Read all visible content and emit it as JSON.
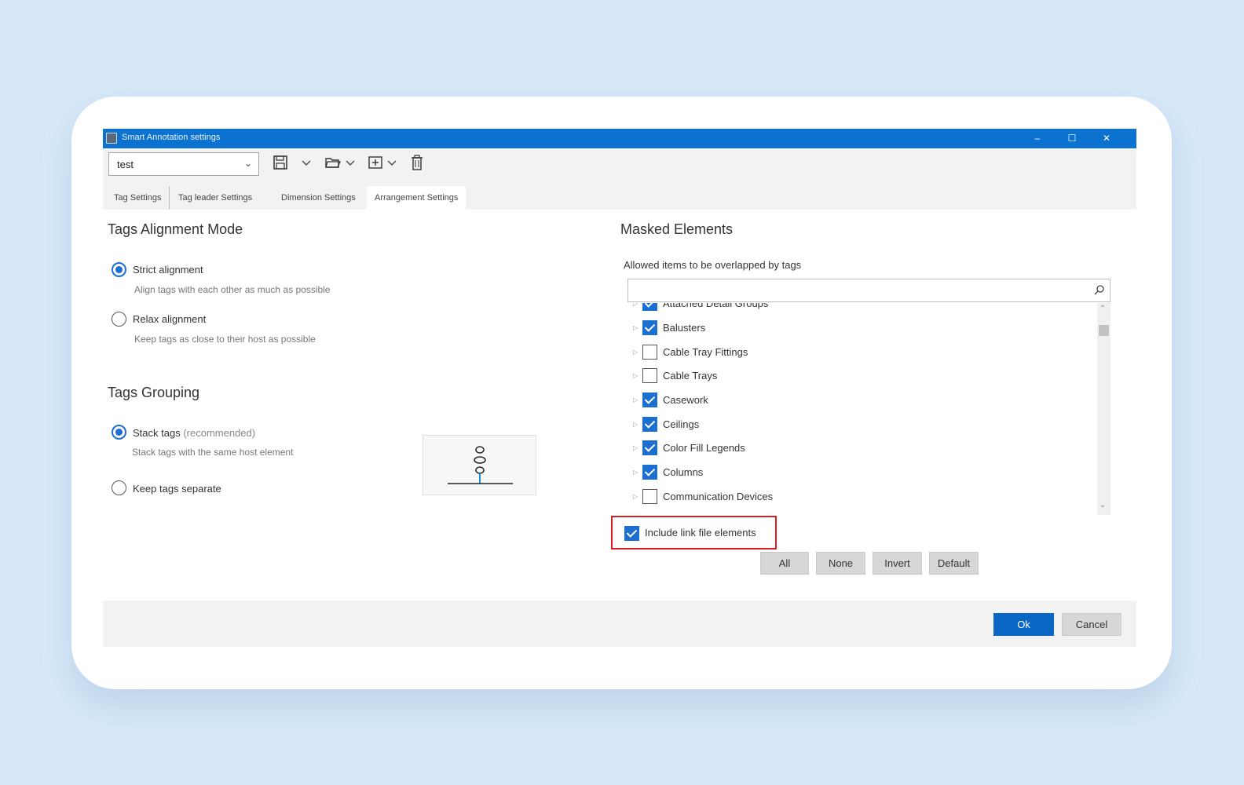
{
  "window": {
    "title": "Smart Annotation settings",
    "controls": {
      "minimize": "–",
      "maximize": "☐",
      "close": "✕"
    }
  },
  "toolbar": {
    "preset_value": "test",
    "icons": [
      "save-icon",
      "chevron-down-icon",
      "folder-open-icon",
      "chevron-down-icon",
      "add-box-icon",
      "chevron-down-icon",
      "trash-icon"
    ]
  },
  "tabs": [
    {
      "label": "Tag Settings",
      "active": false
    },
    {
      "label": "Tag leader Settings",
      "active": false
    },
    {
      "label": "Dimension Settings",
      "active": false
    },
    {
      "label": "Arrangement Settings",
      "active": true
    }
  ],
  "alignment": {
    "title": "Tags Alignment Mode",
    "options": [
      {
        "label": "Strict alignment",
        "desc": "Align tags with each other as much as possible",
        "checked": true
      },
      {
        "label": "Relax alignment",
        "desc": "Keep tags as close to their host as possible",
        "checked": false
      }
    ]
  },
  "grouping": {
    "title": "Tags Grouping",
    "options": [
      {
        "label": "Stack tags",
        "note": "(recommended)",
        "desc": "Stack tags with the same host element",
        "checked": true
      },
      {
        "label": "Keep tags separate",
        "note": "",
        "desc": "",
        "checked": false
      }
    ]
  },
  "masked": {
    "title": "Masked Elements",
    "allowed_label": "Allowed items to be overlapped by tags",
    "search_placeholder": "",
    "items": [
      {
        "label": "Attached Detail Groups",
        "checked": true
      },
      {
        "label": "Balusters",
        "checked": true
      },
      {
        "label": "Cable Tray Fittings",
        "checked": false
      },
      {
        "label": "Cable Trays",
        "checked": false
      },
      {
        "label": "Casework",
        "checked": true
      },
      {
        "label": "Ceilings",
        "checked": true
      },
      {
        "label": "Color Fill Legends",
        "checked": true
      },
      {
        "label": "Columns",
        "checked": true
      },
      {
        "label": "Communication Devices",
        "checked": false
      }
    ],
    "include_link_label": "Include link file elements",
    "include_link_checked": true,
    "buttons": {
      "all": "All",
      "none": "None",
      "invert": "Invert",
      "default": "Default"
    }
  },
  "footer": {
    "ok": "Ok",
    "cancel": "Cancel"
  },
  "colors": {
    "accent": "#0b72cf",
    "highlight": "#d81f26"
  }
}
